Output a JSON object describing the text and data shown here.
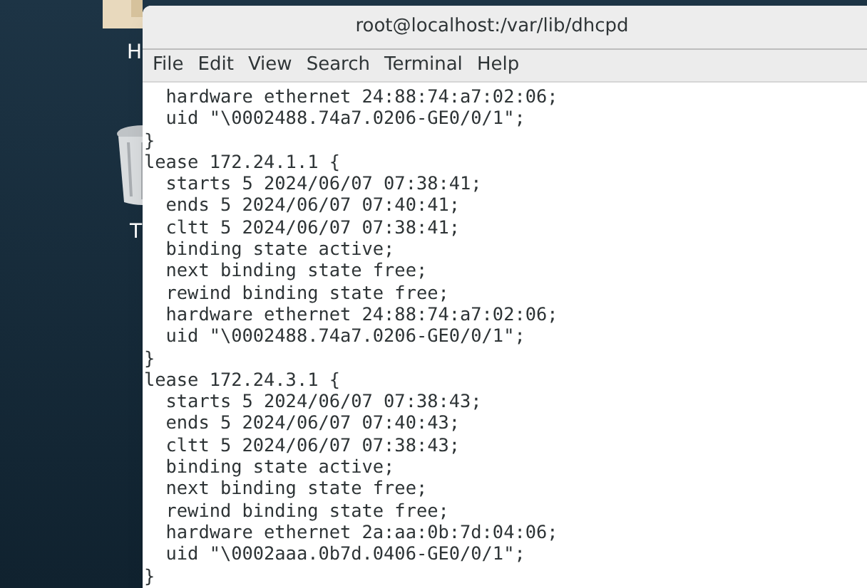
{
  "desktop": {
    "icons": [
      {
        "kind": "folder",
        "label": "H"
      },
      {
        "kind": "trash",
        "label": "T"
      }
    ]
  },
  "window": {
    "title": "root@localhost:/var/lib/dhcpd"
  },
  "menu": [
    "File",
    "Edit",
    "View",
    "Search",
    "Terminal",
    "Help"
  ],
  "terminal": {
    "lines": [
      "  hardware ethernet 24:88:74:a7:02:06;",
      "  uid \"\\0002488.74a7.0206-GE0/0/1\";",
      "}",
      "lease 172.24.1.1 {",
      "  starts 5 2024/06/07 07:38:41;",
      "  ends 5 2024/06/07 07:40:41;",
      "  cltt 5 2024/06/07 07:38:41;",
      "  binding state active;",
      "  next binding state free;",
      "  rewind binding state free;",
      "  hardware ethernet 24:88:74:a7:02:06;",
      "  uid \"\\0002488.74a7.0206-GE0/0/1\";",
      "}",
      "lease 172.24.3.1 {",
      "  starts 5 2024/06/07 07:38:43;",
      "  ends 5 2024/06/07 07:40:43;",
      "  cltt 5 2024/06/07 07:38:43;",
      "  binding state active;",
      "  next binding state free;",
      "  rewind binding state free;",
      "  hardware ethernet 2a:aa:0b:7d:04:06;",
      "  uid \"\\0002aaa.0b7d.0406-GE0/0/1\";",
      "}"
    ]
  }
}
